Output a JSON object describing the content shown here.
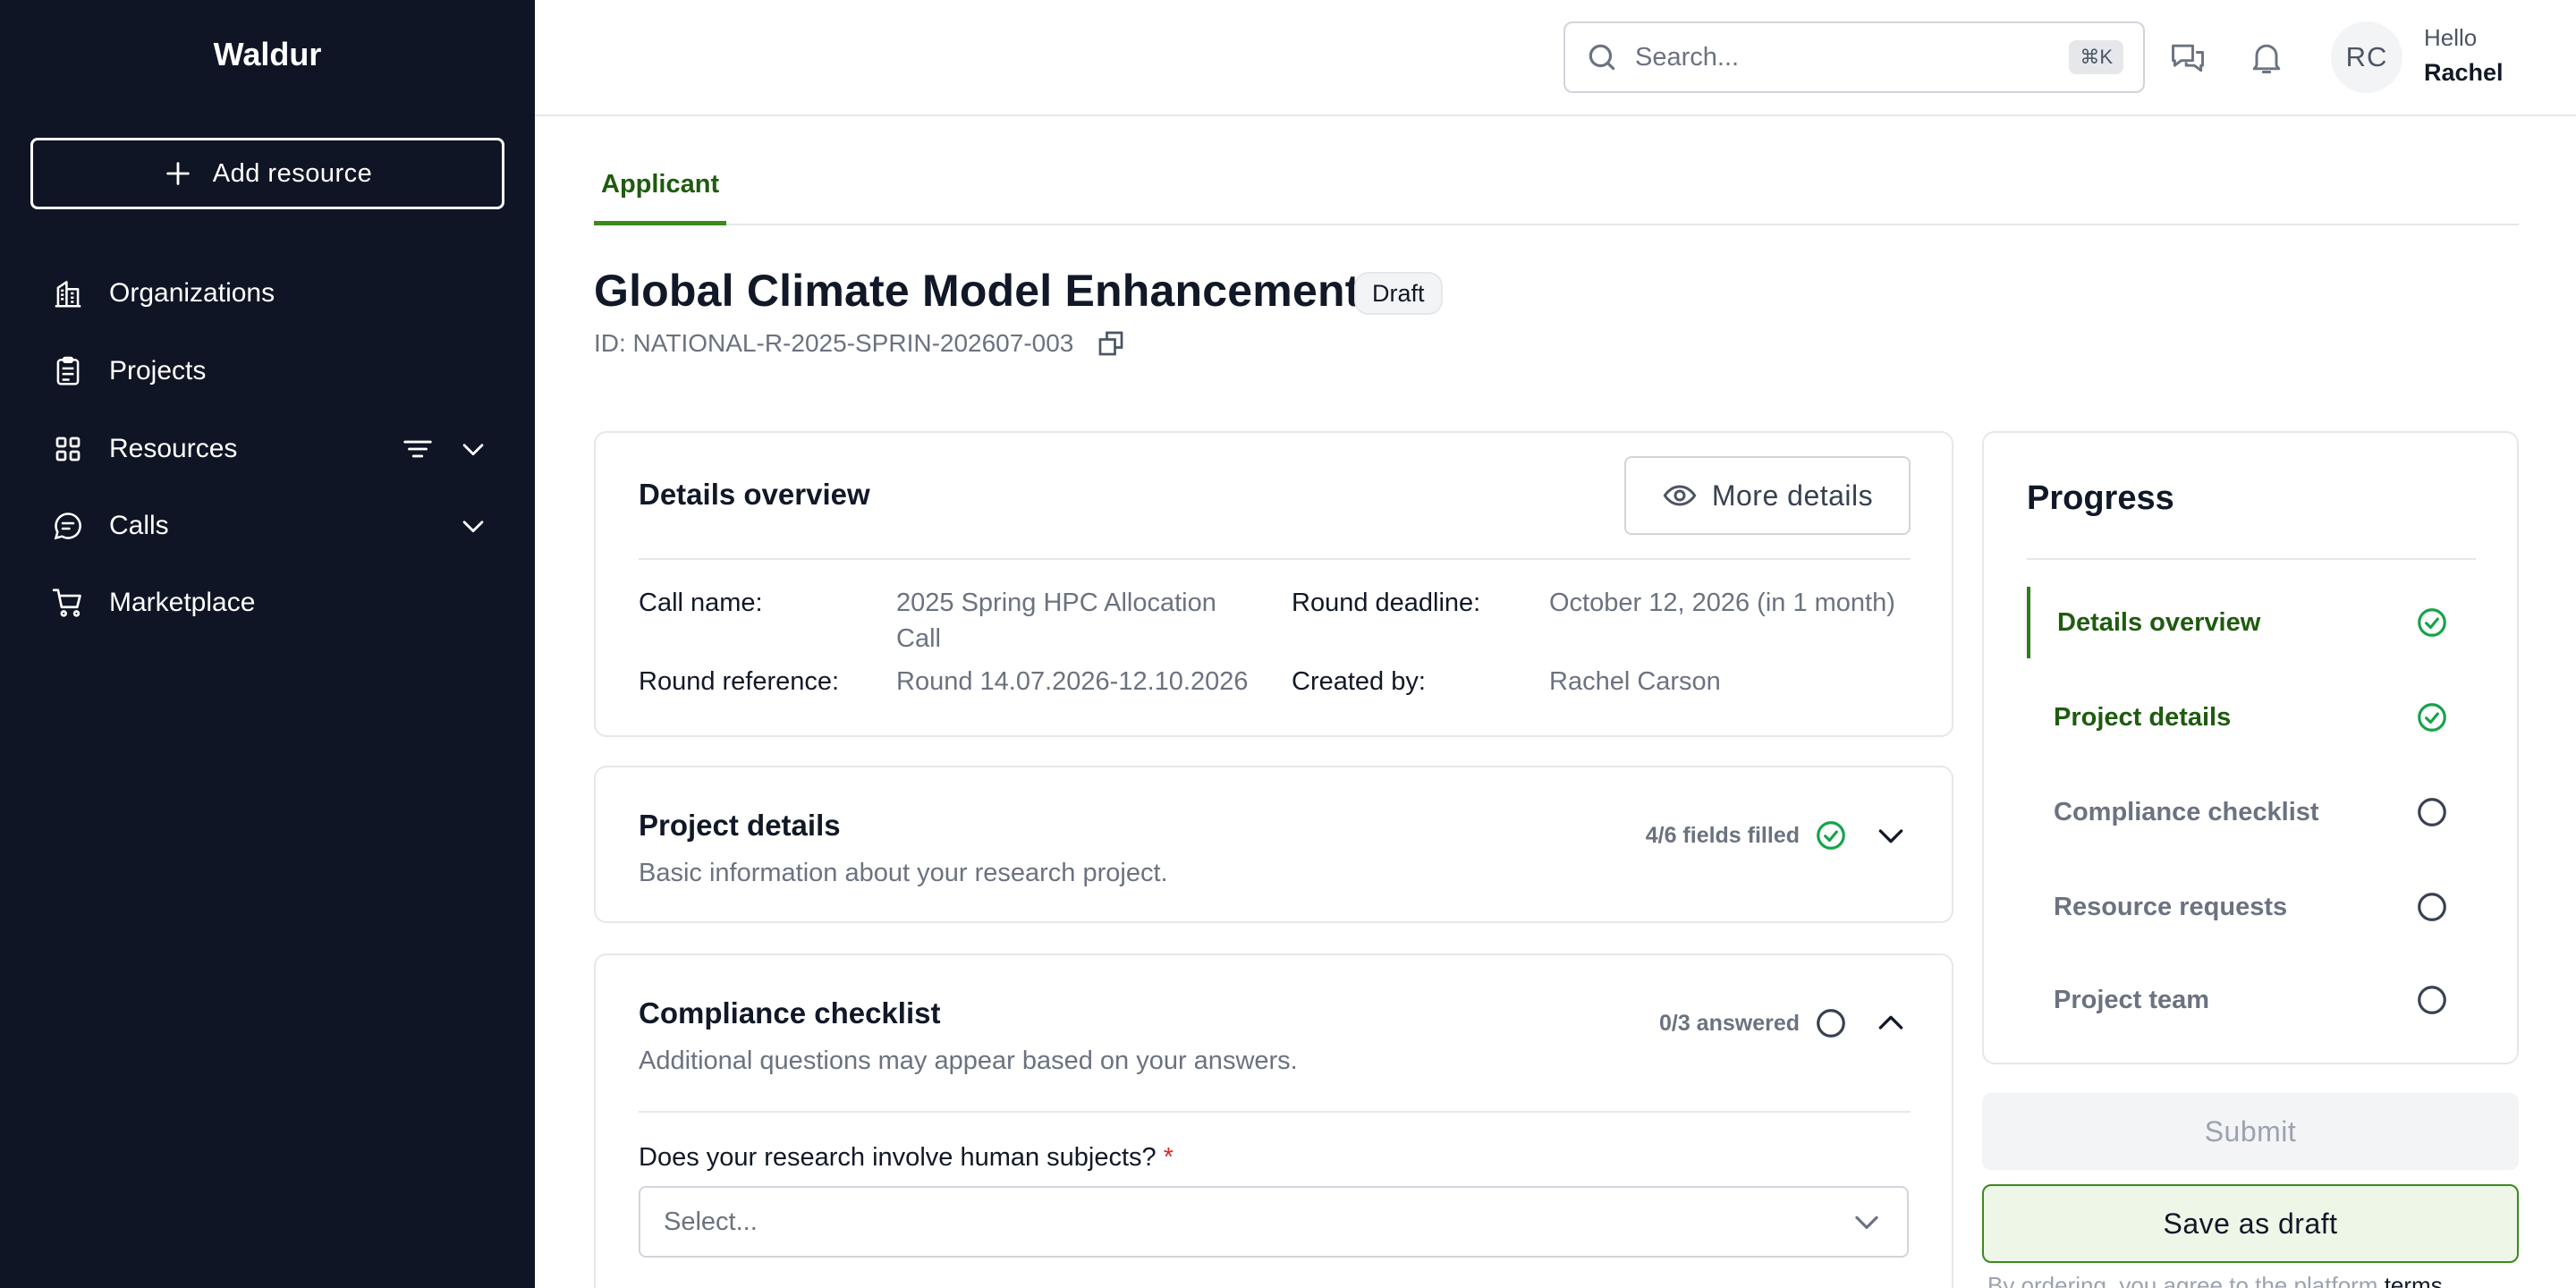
{
  "sidebar": {
    "brand": "Waldur",
    "add_resource_label": "Add resource",
    "items": [
      {
        "label": "Organizations",
        "icon": "building-icon"
      },
      {
        "label": "Projects",
        "icon": "clipboard-icon"
      },
      {
        "label": "Resources",
        "icon": "grid-icon"
      },
      {
        "label": "Calls",
        "icon": "chat-bubble-icon"
      },
      {
        "label": "Marketplace",
        "icon": "cart-icon"
      }
    ]
  },
  "topbar": {
    "search_placeholder": "Search...",
    "search_shortcut": "⌘K",
    "avatar_initials": "RC",
    "greeting": "Hello",
    "user_name": "Rachel"
  },
  "tabs": [
    "Applicant"
  ],
  "header": {
    "title": "Global Climate Model Enhancement",
    "status": "Draft",
    "id": "ID: NATIONAL-R-2025-SPRIN-202607-003"
  },
  "details_overview": {
    "title": "Details overview",
    "more_details_label": "More details",
    "fields": {
      "call_name_label": "Call name:",
      "call_name_line1": "2025 Spring HPC Allocation",
      "call_name_line2": "Call",
      "round_deadline_label": "Round deadline:",
      "round_deadline_value": "October 12, 2026 (in 1 month)",
      "round_reference_label": "Round reference:",
      "round_reference_value": "Round 14.07.2026-12.10.2026",
      "created_by_label": "Created by:",
      "created_by_value": "Rachel Carson"
    }
  },
  "project_details": {
    "title": "Project details",
    "subtitle": "Basic information about your research project.",
    "status": "4/6 fields filled"
  },
  "compliance": {
    "title": "Compliance checklist",
    "subtitle": "Additional questions may appear based on your answers.",
    "status": "0/3 answered",
    "question": "Does your research involve human subjects?",
    "required_mark": "*",
    "select_placeholder": "Select..."
  },
  "progress": {
    "title": "Progress",
    "steps": [
      {
        "label": "Details overview",
        "done": true
      },
      {
        "label": "Project details",
        "done": true
      },
      {
        "label": "Compliance checklist",
        "done": false
      },
      {
        "label": "Resource requests",
        "done": false
      },
      {
        "label": "Project team",
        "done": false
      }
    ],
    "submit_label": "Submit",
    "save_draft_label": "Save as draft",
    "terms_prefix": "By ordering, you agree to the platform",
    "terms_link": "terms"
  },
  "colors": {
    "sidebar_bg": "#0f1525",
    "accent_green": "#3a8a1e",
    "done_green": "#16a34a"
  }
}
